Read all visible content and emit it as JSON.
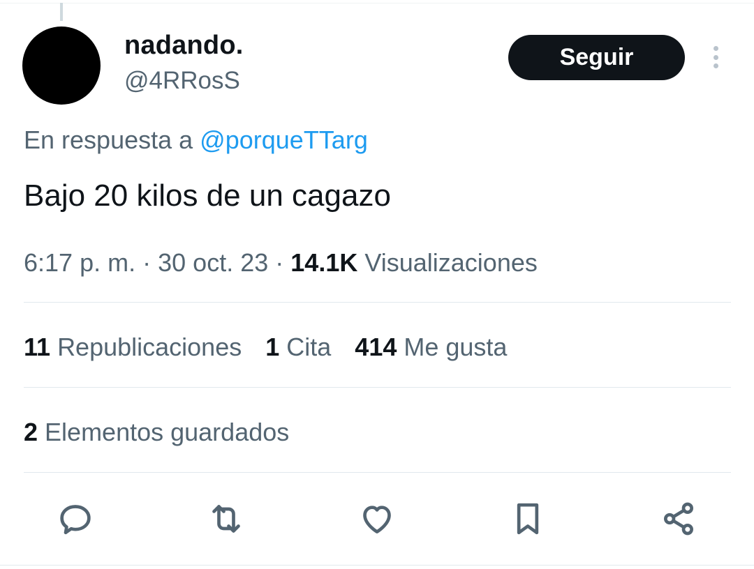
{
  "author": {
    "display_name": "nadando.",
    "handle": "@4RRosS"
  },
  "follow_button": {
    "label": "Seguir"
  },
  "more_menu": {
    "icon": "more-vertical-icon"
  },
  "reply_context": {
    "prefix": "En respuesta a",
    "mention": "@porqueTTarg"
  },
  "tweet": {
    "text": "Bajo 20 kilos de un cagazo"
  },
  "meta": {
    "time": "6:17 p. m.",
    "sep1": "·",
    "date": "30 oct. 23",
    "sep2": "·",
    "views_count": "14.1K",
    "views_label": "Visualizaciones"
  },
  "stats": {
    "reposts": {
      "count": "11",
      "label": "Republicaciones"
    },
    "quotes": {
      "count": "1",
      "label": "Cita"
    },
    "likes": {
      "count": "414",
      "label": "Me gusta"
    }
  },
  "bookmarks": {
    "count": "2",
    "label": "Elementos guardados"
  },
  "actions": [
    {
      "name": "reply",
      "icon": "reply-icon"
    },
    {
      "name": "repost",
      "icon": "repost-icon"
    },
    {
      "name": "like",
      "icon": "heart-icon"
    },
    {
      "name": "bookmark",
      "icon": "bookmark-icon"
    },
    {
      "name": "share",
      "icon": "share-icon"
    }
  ],
  "colors": {
    "primary_text": "#0f1419",
    "secondary_text": "#536471",
    "link": "#1d9bf0",
    "button_bg": "#0f1419"
  }
}
